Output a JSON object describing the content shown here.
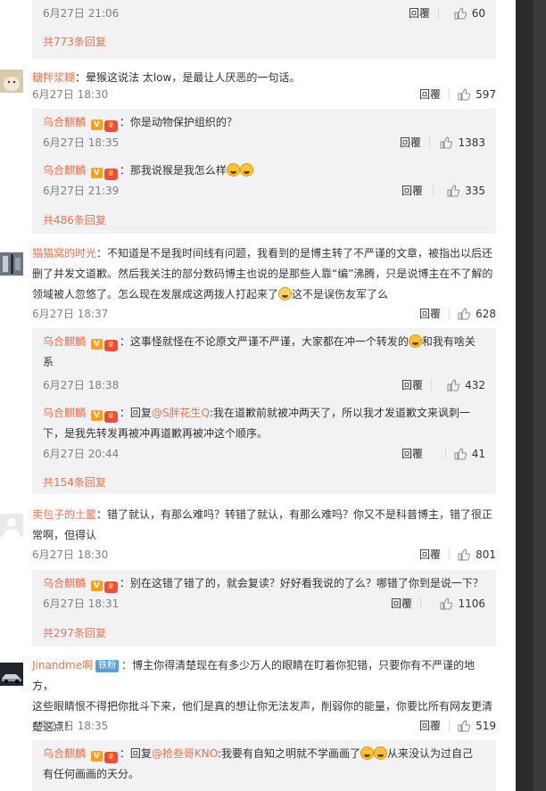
{
  "thread": {
    "top_meta": {
      "time": "6月27日 21:06",
      "reply": "回覆",
      "likes": "60"
    },
    "top_more": "共773条回复",
    "comments": [
      {
        "user": "糖拌浆糊",
        "text": "晕猴这说法 太low，是最让人厌恶的一句话。",
        "time": "6月27日 18:30",
        "reply": "回覆",
        "likes": "597",
        "replies": [
          {
            "user": "乌合麒麟",
            "text": "你是动物保护组织的？",
            "time": "6月27日 18:35",
            "reply": "回覆",
            "likes": "1383"
          },
          {
            "user": "乌合麒麟",
            "text": "那我说猴是我怎么样",
            "time": "6月27日 21:39",
            "reply": "回覆",
            "likes": "335"
          }
        ],
        "more": "共486条回复"
      },
      {
        "user": "猫猫窝的时光",
        "text_line1": "不知道是不是我时间线有问题，我看到的是博主转了不严谨的文章，被指出以后还",
        "text_line2": "删了并发文道歉。然后我关注的部分数码博主也说的是那些人靠“编”沸腾，只是说博主在不了解的",
        "text_line3a": "领域被人忽悠了。怎么现在发展成这两拨人打起来了",
        "text_line3b": "这不是误伤友军了么",
        "time": "6月27日 18:37",
        "reply": "回覆",
        "likes": "628",
        "replies": [
          {
            "user": "乌合麒麟",
            "text_a": "这事怪就怪在不论原文严谨不严谨，大家都在冲一个转发的",
            "text_b": "和我有啥关",
            "text_c": "系",
            "time": "6月27日 18:38",
            "reply": "回覆",
            "likes": "432"
          },
          {
            "user": "乌合麒麟",
            "reply_prefix": "回复",
            "mention": "@S胖花生Q",
            "text_a": ":我在道歉前就被冲两天了，所以我才发道歉文来讽刺一",
            "text_b": "下，是我先转发再被冲再道歉再被冲这个顺序。",
            "time": "6月27日 20:44",
            "reply": "回覆",
            "likes": "41"
          }
        ],
        "more": "共154条回复"
      },
      {
        "user": "卖包子的土鳖",
        "text_a": "错了就认，有那么难吗？转错了就认，有那么难吗？你又不是科普博主，错了很正",
        "text_b": "常啊，但得认",
        "time": "6月27日 18:30",
        "reply": "回覆",
        "likes": "801",
        "replies": [
          {
            "user": "乌合麒麟",
            "text": "别在这错了错了的，就会复读？好好看我说的了么？哪错了你到是说一下？",
            "time": "6月27日 18:31",
            "reply": "回覆",
            "likes": "1106"
          }
        ],
        "more": "共297条回复"
      },
      {
        "user": "Jinandme啊",
        "badge": "铁粉",
        "text_a": "博主你得清楚现在有多少万人的眼睛在盯着你犯错，只要你有不严谨的地方，",
        "text_b": "这些眼睛恨不得把你批斗下来，他们是真的想让你无法发声，削弱你的能量，你要比所有网友更清",
        "text_c": "楚这点！",
        "time": "6月27日 18:35",
        "reply": "回覆",
        "likes": "519",
        "replies": [
          {
            "user": "乌合麒麟",
            "reply_prefix": "回复",
            "mention": "@拾叁哥KNO",
            "text_a": ":我要有自知之明就不学画画了",
            "text_b": "从来没认为过自己",
            "text_c": "有任何画画的天分。"
          }
        ]
      }
    ]
  },
  "colors": {
    "link": "#eb7350",
    "sub_bg": "#f2f2f5",
    "text": "#333333",
    "meta": "#808080"
  }
}
